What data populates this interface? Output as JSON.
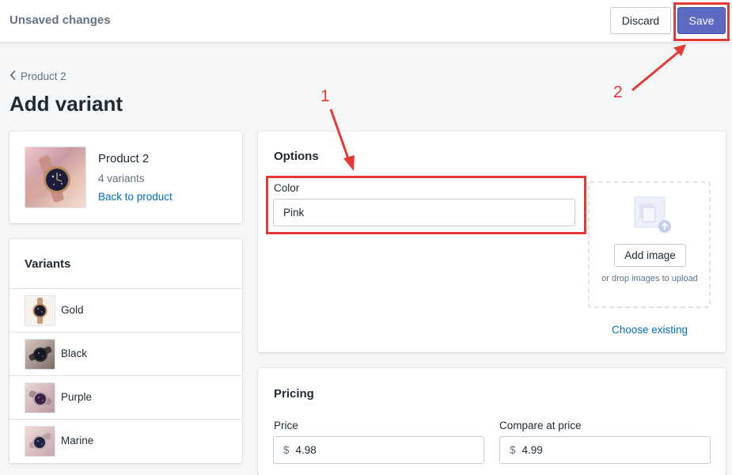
{
  "header": {
    "title": "Unsaved changes",
    "discard_label": "Discard",
    "save_label": "Save"
  },
  "breadcrumb": {
    "label": "Product 2"
  },
  "page": {
    "title": "Add variant"
  },
  "product": {
    "name": "Product 2",
    "variants_count": "4 variants",
    "back_link": "Back to product"
  },
  "variants": {
    "title": "Variants",
    "items": [
      {
        "label": "Gold"
      },
      {
        "label": "Black"
      },
      {
        "label": "Purple"
      },
      {
        "label": "Marine"
      }
    ]
  },
  "options": {
    "title": "Options",
    "color_label": "Color",
    "color_value": "Pink",
    "add_image_label": "Add image",
    "drop_hint": "or drop images to upload",
    "choose_existing": "Choose existing"
  },
  "pricing": {
    "title": "Pricing",
    "price_label": "Price",
    "price_currency": "$",
    "price_value": "4.98",
    "compare_label": "Compare at price",
    "compare_currency": "$",
    "compare_value": "4.99"
  },
  "annotations": {
    "step1": "1",
    "step2": "2",
    "color": "#e53935"
  },
  "colors": {
    "primary": "#5c6ac4",
    "link": "#006fbb",
    "background": "#f4f6f8"
  },
  "icons": [
    "chevron-left-icon",
    "image-upload-icon",
    "watch-thumbnail"
  ]
}
